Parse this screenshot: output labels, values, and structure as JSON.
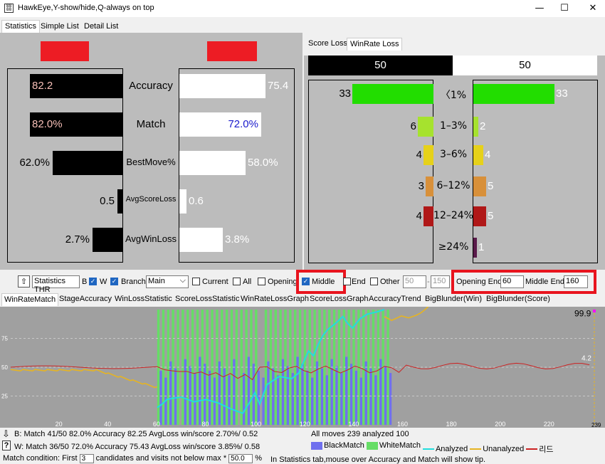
{
  "window": {
    "title": "HawkEye,Y-show/hide,Q-always on top",
    "icon": "app-icon",
    "min": "—",
    "max": "☐",
    "close": "✕"
  },
  "tabs": [
    "Statistics",
    "Simple List",
    "Detail List"
  ],
  "left": {
    "rows": [
      {
        "label": "Accuracy",
        "black": "82.2",
        "white": "75.4",
        "black_frac": 0.82,
        "white_frac": 0.754,
        "size": 15
      },
      {
        "label": "Match",
        "black": "82.0%",
        "white": "72.0%",
        "black_frac": 0.82,
        "white_frac": 0.72,
        "size": 15
      },
      {
        "label": "BestMove%",
        "black": "62.0%",
        "white": "58.0%",
        "black_frac": 0.62,
        "white_frac": 0.58,
        "size": 13
      },
      {
        "label": "AvgScoreLoss",
        "black": "0.5",
        "white": "0.6",
        "black_frac": 0.05,
        "white_frac": 0.06,
        "size": 11
      },
      {
        "label": "AvgWinLoss",
        "black": "2.7%",
        "white": "3.8%",
        "black_frac": 0.27,
        "white_frac": 0.38,
        "size": 13
      }
    ]
  },
  "right": {
    "tabs": [
      "Score Loss",
      "WinRate Loss"
    ],
    "header": {
      "black": "50",
      "white": "50"
    },
    "rows": [
      {
        "label": "〈1%",
        "black": "33",
        "white": "33",
        "color": "#22dd00",
        "black_frac": 0.95,
        "white_frac": 0.95
      },
      {
        "label": "1–3%",
        "black": "6",
        "white": "2",
        "color": "#a6e22e",
        "black_frac": 0.18,
        "white_frac": 0.06
      },
      {
        "label": "3–6%",
        "black": "4",
        "white": "4",
        "color": "#e6d11a",
        "black_frac": 0.12,
        "white_frac": 0.12
      },
      {
        "label": "6–12%",
        "black": "3",
        "white": "5",
        "color": "#d8903a",
        "black_frac": 0.09,
        "white_frac": 0.15
      },
      {
        "label": "12–24%",
        "black": "4",
        "white": "5",
        "color": "#b01818",
        "black_frac": 0.12,
        "white_frac": 0.15
      },
      {
        "label": "≥24%",
        "black": "",
        "white": "1",
        "color": "#5a1a4a",
        "black_frac": 0,
        "white_frac": 0.04
      }
    ]
  },
  "controls": {
    "stats_thr": "Statistics THR",
    "b": "B",
    "w": "W",
    "branch": "Branch",
    "branch_value": "Main",
    "current": "Current",
    "all": "All",
    "opening": "Opening",
    "middle": "Middle",
    "end": "End",
    "other": "Other",
    "other_from": "50",
    "other_to": "150",
    "opening_end_label": "Opening End",
    "opening_end": "60",
    "middle_end_label": "Middle End",
    "middle_end": "160"
  },
  "chart_tabs": [
    "WinRateMatch",
    "StageAccuracy",
    "WinLossStatistic",
    "ScoreLossStatistic",
    "WinRateLossGraph",
    "ScoreLossGraph",
    "AccuracyTrend",
    "BigBlunder(Win)",
    "BigBlunder(Score)"
  ],
  "chart_data": {
    "type": "line",
    "ylim": [
      0,
      100
    ],
    "yticks": [
      "75",
      "50",
      "25"
    ],
    "xticks": [
      "20",
      "40",
      "60",
      "80",
      "100",
      "120",
      "140",
      "160",
      "180",
      "200",
      "220"
    ],
    "xlim": [
      0,
      239
    ],
    "end_label": "239",
    "last_values": {
      "analyzed": "99.9",
      "lead": "4.2"
    },
    "series": [
      {
        "name": "BlackMatch",
        "color": "#7070ee"
      },
      {
        "name": "WhiteMatch",
        "color": "#66dd66"
      },
      {
        "name": "Analyzed",
        "color": "#22dddd"
      },
      {
        "name": "Unanalyzed",
        "color": "#e6b422"
      },
      {
        "name": "리드",
        "color": "#cc2222"
      }
    ]
  },
  "footer": {
    "b_line": "B: Match 41/50 82.0% Accuracy 82.25 AvgLoss win/score 2.70%/ 0.52",
    "w_line": "W: Match 36/50 72.0% Accuracy 75.43 AvgLoss win/score 3.85%/ 0.58",
    "all_moves": "All moves 239 analyzed 100",
    "cond_a": "Match condition: First",
    "cond_b": "3",
    "cond_c": "candidates and visits not below max *",
    "cond_d": "50.0",
    "cond_e": "%",
    "tip": "In Statistics tab,mouse over Accuracy and Match will show tip."
  }
}
